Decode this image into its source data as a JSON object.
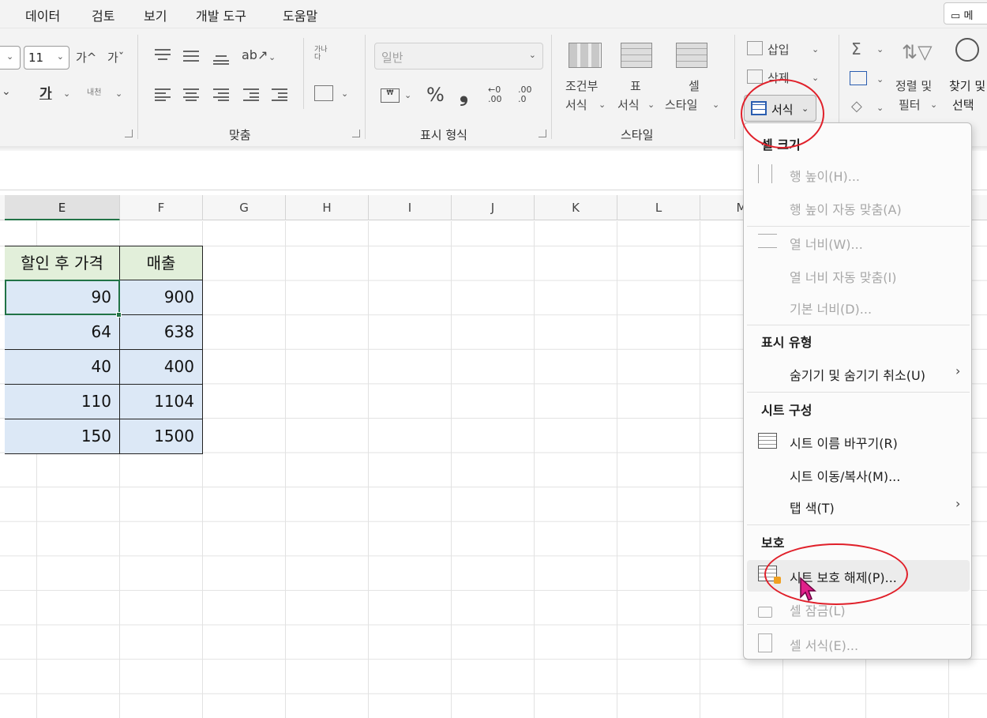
{
  "menubar": {
    "tabs": [
      "데이터",
      "검토",
      "보기",
      "개발 도구",
      "도움말"
    ],
    "comment_label": "메"
  },
  "ribbon": {
    "font": {
      "size_value": "11",
      "grow_label": "가^",
      "shrink_label": "가ˇ",
      "underline_label": "가",
      "phonetic_label": "내천"
    },
    "alignment": {
      "group_label": "맞춤",
      "wrap_label": "가나다"
    },
    "number": {
      "format_value": "일반",
      "percent_label": "%",
      "comma_label": "❟",
      "increase_decimal": ".00",
      "decrease_decimal": ".0",
      "group_label": "표시 형식"
    },
    "styles": {
      "conditional_line1": "조건부",
      "conditional_line2": "서식",
      "table_line1": "표",
      "table_line2": "서식",
      "cell_line1": "셀",
      "cell_line2": "스타일",
      "group_label": "스타일"
    },
    "cells": {
      "insert_label": "삽입",
      "delete_label": "삭제",
      "format_label": "서식"
    },
    "editing": {
      "sort_line1": "정렬 및",
      "sort_line2": "필터",
      "find_line1": "찾기 및",
      "find_line2": "선택"
    }
  },
  "sheet": {
    "columns": [
      "E",
      "F",
      "G",
      "H",
      "I",
      "J",
      "K",
      "L",
      "M"
    ],
    "table": {
      "headers": [
        "할인 후 가격",
        "매출"
      ],
      "rows": [
        [
          "90",
          "900"
        ],
        [
          "64",
          "638"
        ],
        [
          "40",
          "400"
        ],
        [
          "110",
          "1104"
        ],
        [
          "150",
          "1500"
        ]
      ]
    }
  },
  "format_menu": {
    "cell_size_section": "셀 크기",
    "row_height": "행 높이(H)...",
    "row_autofit": "행 높이 자동 맞춤(A)",
    "col_width": "열 너비(W)...",
    "col_autofit": "열 너비 자동 맞춤(I)",
    "default_width": "기본 너비(D)...",
    "visibility_section": "표시 유형",
    "hide_unhide": "숨기기 및 숨기기 취소(U)",
    "organize_section": "시트 구성",
    "rename_sheet": "시트 이름 바꾸기(R)",
    "move_copy": "시트 이동/복사(M)...",
    "tab_color": "탭 색(T)",
    "protection_section": "보호",
    "unprotect_sheet": "시트 보호 해제(P)...",
    "lock_cell": "셀 잠금(L)",
    "format_cells": "셀 서식(E)...",
    "submenu_arrow": "›"
  },
  "colors": {
    "header_fill": "#e2efda",
    "value_fill": "#dce8f6",
    "active_border": "#217346",
    "annotation_red": "#e0202a"
  }
}
